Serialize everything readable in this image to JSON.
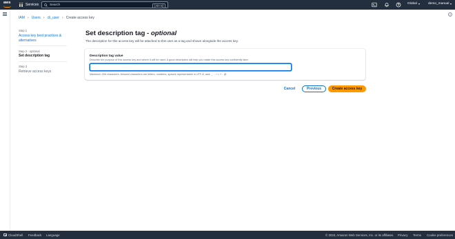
{
  "topnav": {
    "logo_text": "aws",
    "services_label": "Services",
    "search_placeholder": "Search",
    "search_shortcut": "[Alt+S]",
    "region_label": "Global",
    "user_label": "demo_manual"
  },
  "breadcrumb": [
    {
      "label": "IAM"
    },
    {
      "label": "Users"
    },
    {
      "label": "cli_user"
    },
    {
      "label": "Create access key"
    }
  ],
  "steps": [
    {
      "number": "Step 1",
      "label": "Access key best practices & alternatives",
      "state": "link"
    },
    {
      "number": "Step 2 - optional",
      "label": "Set description tag",
      "state": "active"
    },
    {
      "number": "Step 3",
      "label": "Retrieve access keys",
      "state": "disabled"
    }
  ],
  "main": {
    "title": "Set description tag - ",
    "title_optional": "optional",
    "description": "The description for this access key will be attached to this user as a tag and shown alongside the access key.",
    "field": {
      "label": "Description tag value",
      "description": "Describe the purpose of this access key and where it will be used. A good description will help you rotate this access key confidently later.",
      "value": "",
      "constraint": "Maximum 256 characters. Allowed characters are letters, numbers, spaces representable in UTF-8, and: _ . : / = + - @"
    }
  },
  "actions": {
    "cancel_label": "Cancel",
    "previous_label": "Previous",
    "create_label": "Create access key"
  },
  "footer": {
    "cloudshell": "CloudShell",
    "feedback": "Feedback",
    "language": "Language",
    "copyright": "© 2023, Amazon Web Services, Inc. or its affiliates.",
    "privacy": "Privacy",
    "terms": "Terms",
    "cookie": "Cookie preferences"
  },
  "colors": {
    "nav_bg": "#232f3e",
    "link": "#0972d3",
    "primary_button": "#ff9900"
  }
}
